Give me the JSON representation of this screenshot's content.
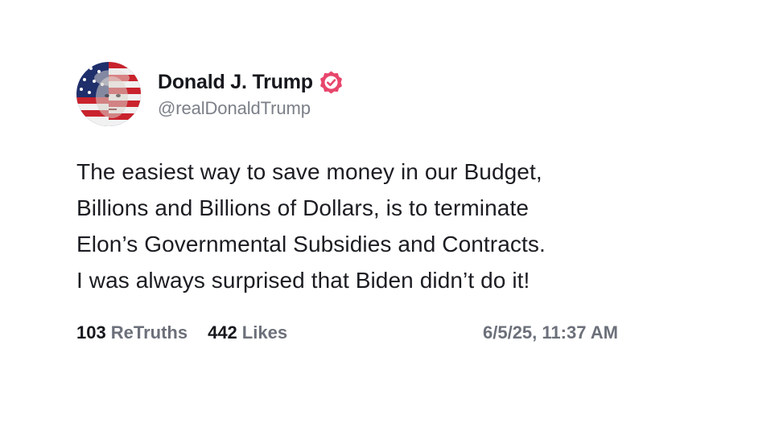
{
  "author": {
    "display_name": "Donald J. Trump",
    "handle": "@realDonaldTrump",
    "verified_icon": "verified-badge-icon",
    "badge_color": "#e8466c"
  },
  "post": {
    "lines": [
      "The easiest way to save money in our Budget,",
      "Billions and Billions of Dollars, is to terminate",
      "Elon’s Governmental Subsidies and Contracts.",
      "I was always surprised that Biden didn’t do it!"
    ]
  },
  "stats": {
    "retruths_count": "103",
    "retruths_label": "ReTruths",
    "likes_count": "442",
    "likes_label": "Likes",
    "timestamp": "6/5/25, 11:37 AM"
  }
}
